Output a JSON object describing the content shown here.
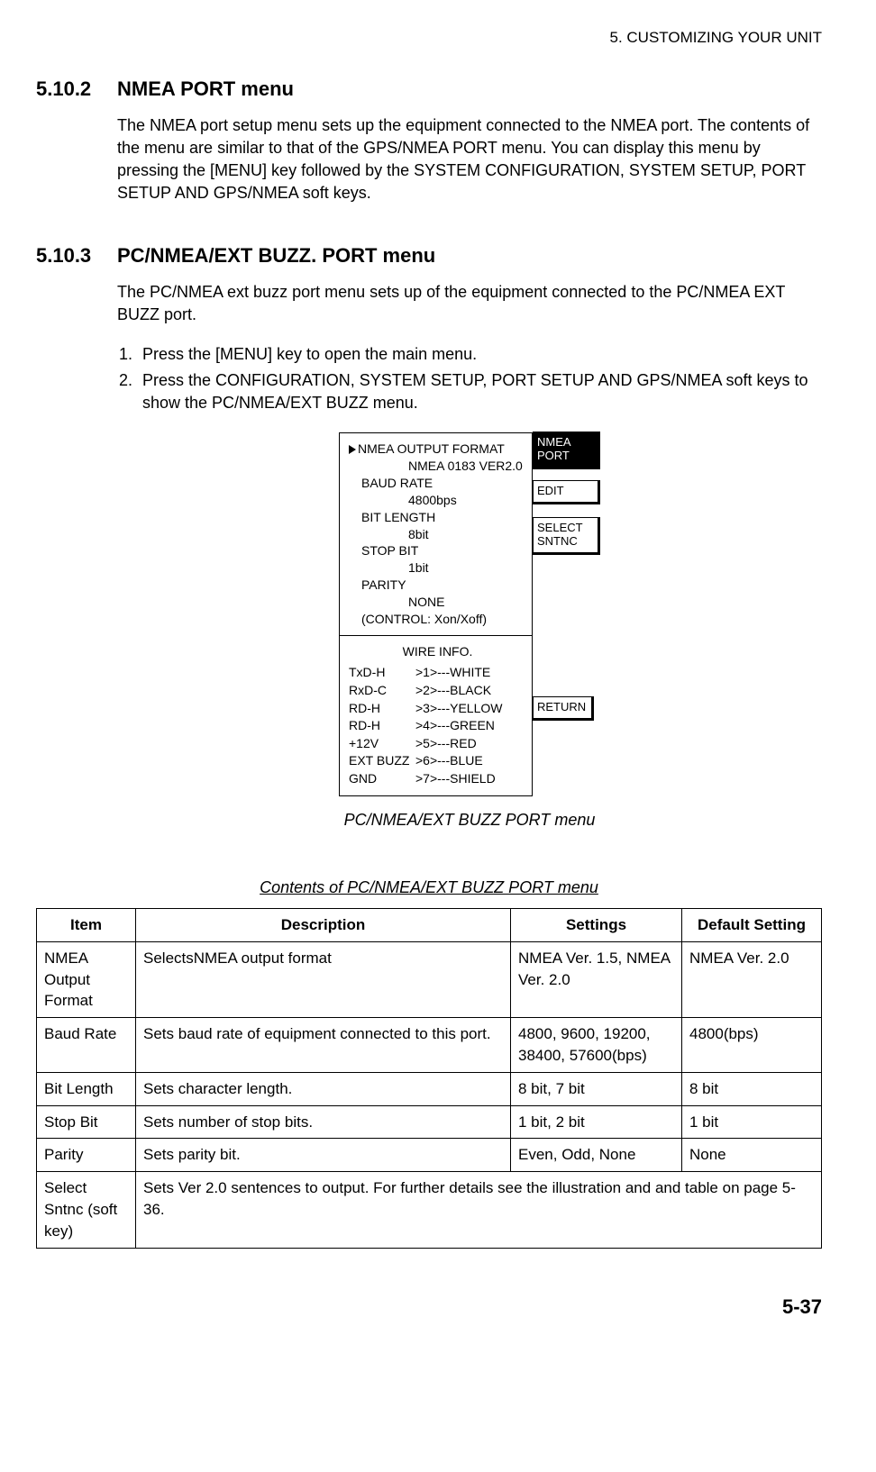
{
  "header": "5. CUSTOMIZING YOUR UNIT",
  "page_number": "5-37",
  "sections": [
    {
      "num": "5.10.2",
      "title": "NMEA PORT menu",
      "para": "The NMEA port setup menu sets up the equipment connected to the NMEA port. The contents of the menu are similar to that of the GPS/NMEA PORT menu. You can display this menu by pressing the [MENU] key followed by the SYSTEM CONFIGURATION, SYSTEM SETUP, PORT SETUP AND GPS/NMEA soft keys."
    },
    {
      "num": "5.10.3",
      "title": "PC/NMEA/EXT BUZZ. PORT menu",
      "para": "The PC/NMEA ext buzz port menu sets up of the equipment connected to the PC/NMEA EXT BUZZ port.",
      "steps": [
        "Press the [MENU] key to open the main menu.",
        "Press the CONFIGURATION, SYSTEM SETUP, PORT SETUP AND GPS/NMEA soft keys to show the PC/NMEA/EXT BUZZ menu."
      ]
    }
  ],
  "diagram": {
    "items": [
      {
        "label": "NMEA OUTPUT FORMAT",
        "value": "NMEA 0183 VER2.0"
      },
      {
        "label": "BAUD RATE",
        "value": "4800bps"
      },
      {
        "label": "BIT LENGTH",
        "value": "8bit"
      },
      {
        "label": "STOP BIT",
        "value": "1bit"
      },
      {
        "label": "PARITY",
        "value": "NONE"
      }
    ],
    "control": "(CONTROL: Xon/Xoff)",
    "wire_title": "WIRE INFO.",
    "wires": [
      {
        "a": "TxD-H",
        "b": ">1>---WHITE"
      },
      {
        "a": "RxD-C",
        "b": ">2>---BLACK"
      },
      {
        "a": "RD-H",
        "b": ">3>---YELLOW"
      },
      {
        "a": "RD-H",
        "b": ">4>---GREEN"
      },
      {
        "a": "+12V",
        "b": ">5>---RED"
      },
      {
        "a": "EXT BUZZ",
        "b": ">6>---BLUE"
      },
      {
        "a": "GND",
        "b": ">7>---SHIELD"
      }
    ],
    "softkeys": {
      "top1": "NMEA",
      "top2": "PORT",
      "edit": "EDIT",
      "select1": "SELECT",
      "select2": "SNTNC",
      "return": "RETURN"
    }
  },
  "fig_caption": "PC/NMEA/EXT BUZZ PORT menu",
  "table_title": "Contents of PC/NMEA/EXT BUZZ PORT menu",
  "table": {
    "headers": [
      "Item",
      "Description",
      "Settings",
      "Default Setting"
    ],
    "rows": [
      {
        "c0": "NMEA Output Format",
        "c1": "SelectsNMEA output format",
        "c2": "NMEA Ver. 1.5, NMEA Ver. 2.0",
        "c3": "NMEA Ver. 2.0"
      },
      {
        "c0": "Baud Rate",
        "c1": "Sets baud rate of equipment connected to this port.",
        "c2": "4800, 9600, 19200, 38400, 57600(bps)",
        "c3": "4800(bps)"
      },
      {
        "c0": "Bit Length",
        "c1": "Sets character length.",
        "c2": "8 bit, 7 bit",
        "c3": "8 bit"
      },
      {
        "c0": "Stop Bit",
        "c1": "Sets number of stop bits.",
        "c2": "1 bit, 2 bit",
        "c3": "1 bit"
      },
      {
        "c0": "Parity",
        "c1": "Sets parity bit.",
        "c2": "Even, Odd, None",
        "c3": "None"
      }
    ],
    "lastrow": {
      "c0": "Select Sntnc (soft key)",
      "c1": "Sets Ver 2.0 sentences to output. For further details see the illustration and and table on page 5-36."
    }
  }
}
